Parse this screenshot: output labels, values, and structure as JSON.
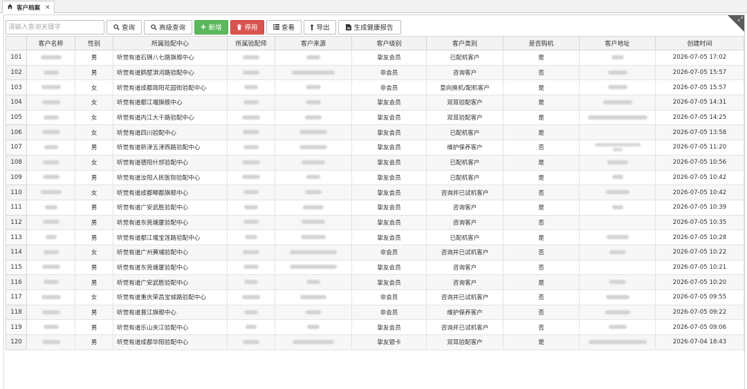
{
  "tab": {
    "title": "客户档案",
    "home_icon": "home-icon",
    "close_label": "×"
  },
  "toolbar": {
    "search_placeholder": "请输入查询关键字",
    "search_label": "查询",
    "advanced_label": "高级查询",
    "add_label": "新增",
    "disable_label": "停用",
    "view_label": "查看",
    "export_label": "导出",
    "report_label": "生成健康报告"
  },
  "colors": {
    "add_button": "#5cb85c",
    "disable_button": "#d9534f",
    "header_bg": "#f3f3f3"
  },
  "columns": [
    "",
    "客户名称",
    "性别",
    "所属验配中心",
    "所属验配师",
    "客户来源",
    "客户级别",
    "客户类别",
    "是否购机",
    "客户地址",
    "创建时间"
  ],
  "rows": [
    {
      "num": "101",
      "gender": "男",
      "center": "听觉有道石狮八七路旗舰中心",
      "level": "挚友会员",
      "category": "已配机客户",
      "bought": "是",
      "created": "2026-07-05 17:02"
    },
    {
      "num": "102",
      "gender": "男",
      "center": "听觉有道鹤壁淇河路验配中心",
      "level": "非会员",
      "category": "咨询客户",
      "bought": "否",
      "created": "2026-07-05 15:57"
    },
    {
      "num": "103",
      "gender": "女",
      "center": "听觉有道成都简阳花园街验配中心",
      "level": "非会员",
      "category": "意向换机/配机客户",
      "bought": "是",
      "created": "2026-07-05 15:57"
    },
    {
      "num": "104",
      "gender": "女",
      "center": "听觉有道都江堰旗舰中心",
      "level": "挚友会员",
      "category": "双耳验配客户",
      "bought": "是",
      "created": "2026-07-05 14:31"
    },
    {
      "num": "105",
      "gender": "女",
      "center": "听觉有道内江大千路验配中心",
      "level": "挚友会员",
      "category": "双耳验配客户",
      "bought": "是",
      "created": "2026-07-05 14:25"
    },
    {
      "num": "106",
      "gender": "女",
      "center": "听觉有道四川验配中心",
      "level": "挚友会员",
      "category": "已配机客户",
      "bought": "是",
      "created": "2026-07-05 13:58"
    },
    {
      "num": "107",
      "gender": "男",
      "center": "听觉有道新津五津西路验配中心",
      "level": "挚友会员",
      "category": "维护保养客户",
      "bought": "否",
      "created": "2026-07-05 11:20"
    },
    {
      "num": "108",
      "gender": "女",
      "center": "听觉有道德阳什邡验配中心",
      "level": "挚友会员",
      "category": "已配机客户",
      "bought": "是",
      "created": "2026-07-05 10:56"
    },
    {
      "num": "109",
      "gender": "男",
      "center": "听觉有道汝阳人民医院验配中心",
      "level": "挚友会员",
      "category": "已配机客户",
      "bought": "是",
      "created": "2026-07-05 10:42"
    },
    {
      "num": "110",
      "gender": "女",
      "center": "听觉有道成都郫都旗舰中心",
      "level": "挚友会员",
      "category": "咨询并已试机客户",
      "bought": "否",
      "created": "2026-07-05 10:42"
    },
    {
      "num": "111",
      "gender": "男",
      "center": "听觉有道广安武胜验配中心",
      "level": "挚友会员",
      "category": "咨询客户",
      "bought": "是",
      "created": "2026-07-05 10:39"
    },
    {
      "num": "112",
      "gender": "男",
      "center": "听觉有道东莞塘厦验配中心",
      "level": "挚友会员",
      "category": "咨询客户",
      "bought": "否",
      "created": "2026-07-05 10:35"
    },
    {
      "num": "113",
      "gender": "男",
      "center": "听觉有道都江堰宝莲路验配中心",
      "level": "挚友会员",
      "category": "已配机客户",
      "bought": "是",
      "created": "2026-07-05 10:28"
    },
    {
      "num": "114",
      "gender": "女",
      "center": "听觉有道广州黄埔验配中心",
      "level": "非会员",
      "category": "咨询并已试机客户",
      "bought": "否",
      "created": "2026-07-05 10:22"
    },
    {
      "num": "115",
      "gender": "男",
      "center": "听觉有道东莞塘厦验配中心",
      "level": "挚友会员",
      "category": "咨询客户",
      "bought": "否",
      "created": "2026-07-05 10:21"
    },
    {
      "num": "116",
      "gender": "男",
      "center": "听觉有道广安武胜验配中心",
      "level": "挚友会员",
      "category": "咨询客户",
      "bought": "是",
      "created": "2026-07-05 10:20"
    },
    {
      "num": "117",
      "gender": "女",
      "center": "听觉有道重庆荣昌宝城路验配中心",
      "level": "非会员",
      "category": "咨询并已试机客户",
      "bought": "否",
      "created": "2026-07-05 09:55"
    },
    {
      "num": "118",
      "gender": "男",
      "center": "听觉有道晋江旗舰中心",
      "level": "非会员",
      "category": "维护保养客户",
      "bought": "否",
      "created": "2026-07-05 09:22"
    },
    {
      "num": "119",
      "gender": "男",
      "center": "听觉有道乐山夹江验配中心",
      "level": "挚友会员",
      "category": "咨询并已试机客户",
      "bought": "否",
      "created": "2026-07-05 09:06"
    },
    {
      "num": "120",
      "gender": "男",
      "center": "听觉有道成都华阳验配中心",
      "level": "挚友银卡",
      "category": "双耳验配客户",
      "bought": "是",
      "created": "2026-07-04 18:43"
    }
  ]
}
